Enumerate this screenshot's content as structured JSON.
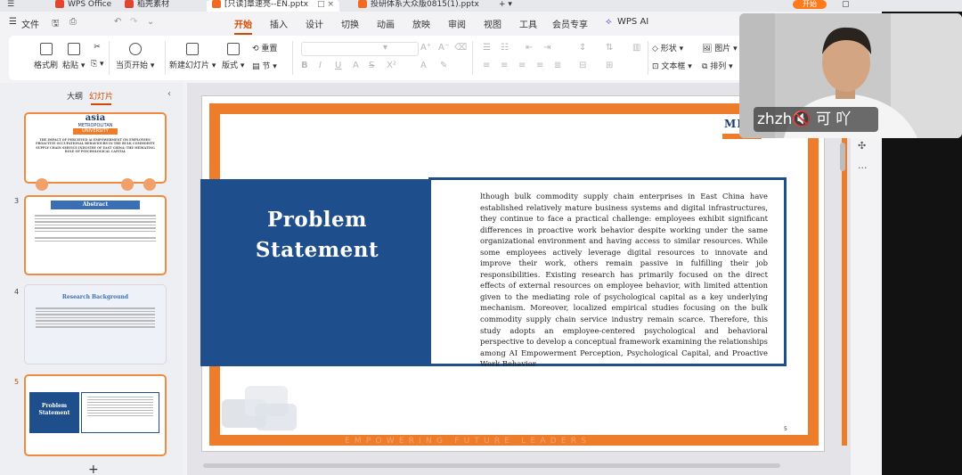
{
  "titlebar": {
    "menu": "文件",
    "tabs": [
      {
        "label": "WPS Office",
        "color": "#e2452f"
      },
      {
        "label": "稻壳素材",
        "color": "#e2452f"
      },
      {
        "label": "[只读]章速亮--EN.pptx",
        "color": "#f06a21"
      },
      {
        "label": "投研体系大众版0815(1).pptx",
        "color": "#f06a21"
      }
    ],
    "upgrade": "开始"
  },
  "menubar": {
    "file": "文件",
    "items": [
      "开始",
      "插入",
      "设计",
      "切换",
      "动画",
      "放映",
      "审阅",
      "视图",
      "工具",
      "会员专享"
    ],
    "wps_ai": "WPS AI"
  },
  "ribbon": {
    "format_painter": "格式刷",
    "paste": "粘贴",
    "play_current": "当页开始",
    "new_slide": "新建幻灯片",
    "layout": "版式",
    "reset": "重置",
    "section": "节",
    "shape": "形状",
    "picture": "图片",
    "textbox": "文本框",
    "arrange": "排列"
  },
  "left_panel": {
    "tab_outline": "大纲",
    "tab_slides": "幻灯片",
    "slides": [
      {
        "num": "",
        "logo_top": "asia",
        "logo_mid": "METROPOLITAN",
        "logo_bottom": "UNIVERSITY",
        "heading": "THE IMPACT OF PERCEIVED AI EMPOWERMENT ON EMPLOYEES' PROACTIVE OCCUPATIONAL BEHAVIOURS IN THE BULK COMMODITY SUPPLY CHAIN SERVICE INDUSTRY OF EAST CHINA: THE MEDIATING ROLE OF PSYCHOLOGICAL CAPITAL"
      },
      {
        "num": "3",
        "heading": "Abstract"
      },
      {
        "num": "4",
        "heading": "Research Background"
      },
      {
        "num": "5",
        "heading": "Problem Statement"
      }
    ]
  },
  "slide": {
    "logo": "ME",
    "title_line1": "Problem",
    "title_line2": "Statement",
    "body": "lthough bulk commodity supply chain enterprises in East China have established relatively mature business systems and digital infrastructures, they continue to face a practical challenge: employees exhibit significant differences in proactive work behavior despite working under the same organizational environment and having access to similar resources. While some employees actively leverage digital resources to innovate and improve their work, others remain passive in fulfilling their job responsibilities. Existing research has primarily focused on the direct effects of external resources on employee behavior, with limited attention given to the mediating role of psychological capital as a key underlying mechanism. Moreover, localized empirical studies focusing on the bulk commodity supply chain service industry remain scarce. Therefore, this study adopts an employee-centered psychological and behavioral perspective to develop a conceptual framework examining the relationships among AI Empowerment Perception, Psychological Capital, and Proactive Work Behavior.",
    "page_number": "5",
    "tagline": "EMPOWERING FUTURE LEADERS"
  },
  "webcam": {
    "caption": "zhzh🔇 可 吖"
  }
}
